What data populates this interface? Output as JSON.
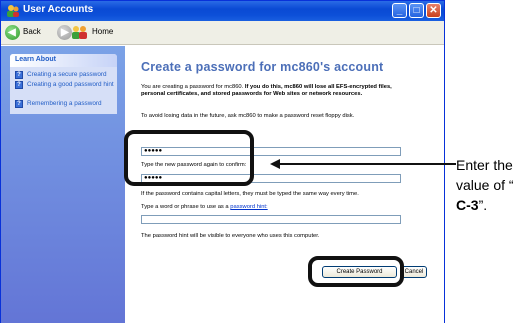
{
  "window": {
    "title": "User Accounts"
  },
  "toolbar": {
    "back_label": "Back",
    "home_label": "Home"
  },
  "sidebar": {
    "panel_title": "Learn About",
    "items": [
      {
        "label": "Creating a secure password"
      },
      {
        "label": "Creating a good password hint"
      },
      {
        "label": "Remembering a password"
      }
    ]
  },
  "main": {
    "heading": "Create a password for mc860's account",
    "intro_plain": "You are creating a password for mc860.",
    "intro_bold": "If you do this, mc860 will lose all EFS-encrypted files, personal certificates, and stored passwords for Web sites or network resources.",
    "floppy_note": "To avoid losing data in the future, ask mc860 to make a password reset floppy disk.",
    "password_value": "●●●●●",
    "confirm_label": "Type the new password again to confirm:",
    "confirm_value": "●●●●●",
    "caps_note": "If the password contains capital letters, they must be typed the same way every time.",
    "hint_label_prefix": "Type a word or phrase to use as a",
    "hint_link": "password hint:",
    "hint_value": "",
    "hint_note": "The password hint will be visible to everyone who uses this computer.",
    "create_button": "Create Password",
    "cancel_button": "Cancel"
  },
  "annotation": {
    "line1": "Enter the",
    "line2": "value of “",
    "line3": "C-3",
    "line3_suffix": "”."
  }
}
